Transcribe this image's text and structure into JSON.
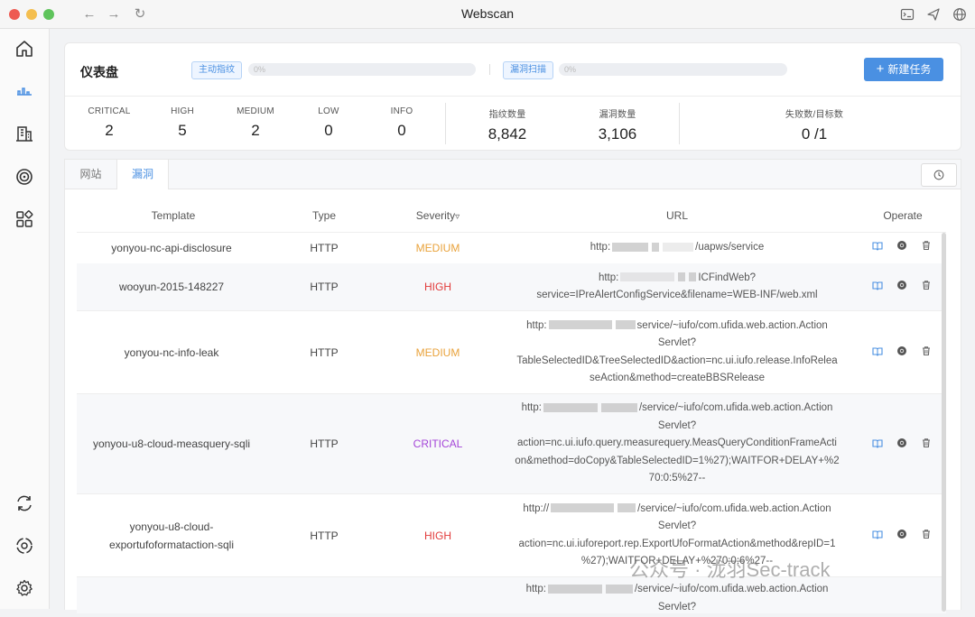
{
  "window": {
    "title": "Webscan"
  },
  "dashboard": {
    "title": "仪表盘",
    "fingerprint_tag": "主动指纹",
    "fingerprint_progress": "0%",
    "vuln_tag": "漏洞扫描",
    "vuln_progress": "0%",
    "new_task_label": "新建任务",
    "stats": [
      {
        "label": "CRITICAL",
        "value": "2"
      },
      {
        "label": "HIGH",
        "value": "5"
      },
      {
        "label": "MEDIUM",
        "value": "2"
      },
      {
        "label": "LOW",
        "value": "0"
      },
      {
        "label": "INFO",
        "value": "0"
      },
      {
        "label": "指纹数量",
        "value": "8,842"
      },
      {
        "label": "漏洞数量",
        "value": "3,106"
      },
      {
        "label": "失败数/目标数",
        "value": "0 /1"
      }
    ]
  },
  "tabs": [
    {
      "label": "网站"
    },
    {
      "label": "漏洞"
    }
  ],
  "table": {
    "headers": {
      "template": "Template",
      "type": "Type",
      "severity": "Severity",
      "url": "URL",
      "operate": "Operate"
    },
    "rows": [
      {
        "template": "yonyou-nc-api-disclosure",
        "type": "HTTP",
        "severity": "MEDIUM",
        "url_prefix": "http:",
        "url": "/uapws/service"
      },
      {
        "template": "wooyun-2015-148227",
        "type": "HTTP",
        "severity": "HIGH",
        "url_prefix": "http:",
        "url": "ICFindWeb?\nservice=IPreAlertConfigService&filename=WEB-INF/web.xml"
      },
      {
        "template": "yonyou-nc-info-leak",
        "type": "HTTP",
        "severity": "MEDIUM",
        "url_prefix": "http:",
        "url": "service/~iufo/com.ufida.web.action.Action\nServlet?\nTableSelectedID&TreeSelectedID&action=nc.ui.iufo.release.InfoRelea\nseAction&method=createBBSRelease"
      },
      {
        "template": "yonyou-u8-cloud-measquery-sqli",
        "type": "HTTP",
        "severity": "CRITICAL",
        "url_prefix": "http:",
        "url": "/service/~iufo/com.ufida.web.action.Action\nServlet?\naction=nc.ui.iufo.query.measurequery.MeasQueryConditionFrameActi\non&method=doCopy&TableSelectedID=1%27);WAITFOR+DELAY+%2\n70:0:5%27--"
      },
      {
        "template": "yonyou-u8-cloud-\nexportufoformataction-sqli",
        "type": "HTTP",
        "severity": "HIGH",
        "url_prefix": "http://",
        "url": "/service/~iufo/com.ufida.web.action.Action\nServlet?\naction=nc.ui.iuforeport.rep.ExportUfoFormatAction&method&repID=1\n%27);WAITFOR+DELAY+%270:0:6%27--"
      },
      {
        "template": "",
        "type": "",
        "severity": "",
        "url_prefix": "http:",
        "url": "/service/~iufo/com.ufida.web.action.Action\nServlet?"
      }
    ]
  },
  "watermark": "公众号 · 泷羽Sec-track",
  "colors": {
    "accent": "#4a90e2",
    "medium": "#e9a23b",
    "high": "#e23b3b",
    "critical": "#a445d8"
  }
}
